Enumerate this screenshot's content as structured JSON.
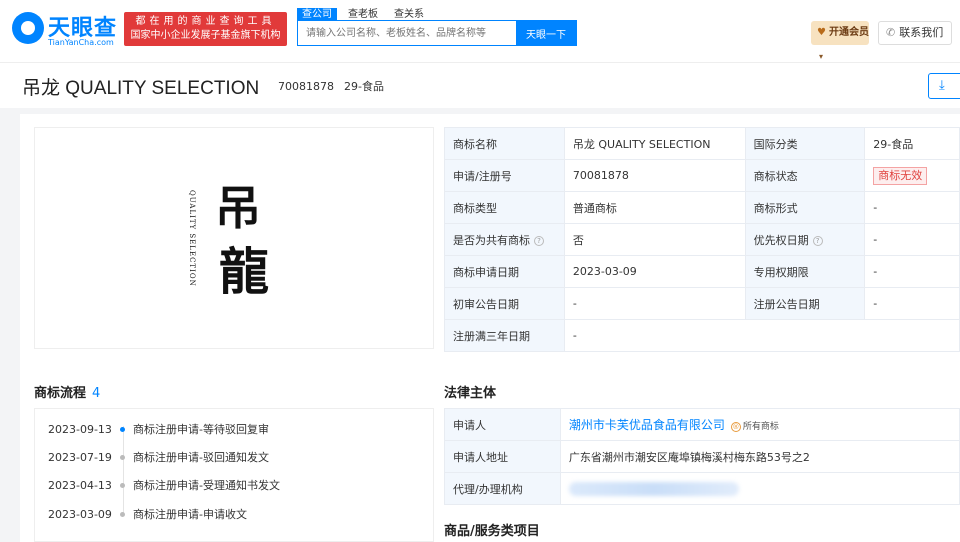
{
  "header": {
    "logo_text": "天眼查",
    "logo_sub": "TianYanCha.com",
    "slogan_line1": "都在用的商业查询工具",
    "slogan_line2": "国家中小企业发展子基金旗下机构",
    "tabs": [
      "查公司",
      "查老板",
      "查关系"
    ],
    "search_placeholder": "请输入公司名称、老板姓名、品牌名称等",
    "search_button": "天眼一下",
    "vip_label": "开通会员",
    "contact_label": "联系我们"
  },
  "title": {
    "name": "吊龙 QUALITY SELECTION",
    "reg_no": "70081878",
    "category": "29-食品"
  },
  "brand_art": {
    "glyph_top": "吊",
    "glyph_bottom": "龍",
    "side_text": "QUALITY SELECTION"
  },
  "info": {
    "rows": [
      {
        "k1": "商标名称",
        "v1": "吊龙 QUALITY SELECTION",
        "k2": "国际分类",
        "v2": "29-食品"
      },
      {
        "k1": "申请/注册号",
        "v1": "70081878",
        "k2": "商标状态",
        "v2": "商标无效"
      },
      {
        "k1": "商标类型",
        "v1": "普通商标",
        "k2": "商标形式",
        "v2": "-"
      },
      {
        "k1": "是否为共有商标",
        "v1": "否",
        "k2": "优先权日期",
        "v2": "-"
      },
      {
        "k1": "商标申请日期",
        "v1": "2023-03-09",
        "k2": "专用权期限",
        "v2": "-"
      },
      {
        "k1": "初审公告日期",
        "v1": "-",
        "k2": "注册公告日期",
        "v2": "-"
      },
      {
        "k1": "注册满三年日期",
        "v1": "-"
      }
    ]
  },
  "flow": {
    "title": "商标流程",
    "count": "4",
    "items": [
      {
        "date": "2023-09-13",
        "text": "商标注册申请-等待驳回复审"
      },
      {
        "date": "2023-07-19",
        "text": "商标注册申请-驳回通知发文"
      },
      {
        "date": "2023-04-13",
        "text": "商标注册申请-受理通知书发文"
      },
      {
        "date": "2023-03-09",
        "text": "商标注册申请-申请收文"
      }
    ]
  },
  "legal": {
    "title": "法律主体",
    "applicant_label": "申请人",
    "applicant": "潮州市卡芙优品食品有限公司",
    "owner_tag": "所有商标",
    "address_label": "申请人地址",
    "address": "广东省潮州市潮安区庵埠镇梅溪村梅东路53号之2",
    "agent_label": "代理/办理机构"
  },
  "goods": {
    "title": "商品/服务类项目"
  }
}
